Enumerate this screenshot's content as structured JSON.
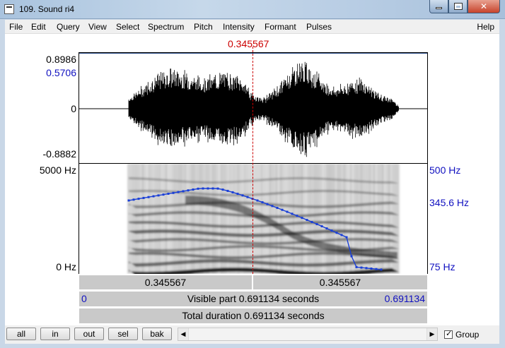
{
  "window": {
    "title": "109. Sound ri4"
  },
  "menu": [
    "File",
    "Edit",
    "Query",
    "View",
    "Select",
    "Spectrum",
    "Pitch",
    "Intensity",
    "Formant",
    "Pulses"
  ],
  "menu_help": "Help",
  "cursor": {
    "time": "0.345567",
    "color": "#cc0000"
  },
  "waveform": {
    "max_label": "0.8986",
    "cursor_value_label": "0.5706",
    "zero_label": "0",
    "min_label": "-0.8882"
  },
  "spectrogram": {
    "freq_top": "5000 Hz",
    "freq_bottom": "0 Hz",
    "pitch_top": "500 Hz",
    "pitch_cursor": "345.6 Hz",
    "pitch_bottom": "75 Hz",
    "pitch_color": "#1a3fd6"
  },
  "bars": {
    "left_part": "0.345567",
    "right_part": "0.345567",
    "visible_start": "0",
    "visible_text": "Visible part 0.691134 seconds",
    "visible_end": "0.691134",
    "total_text": "Total duration 0.691134 seconds"
  },
  "toolbar": {
    "buttons": [
      "all",
      "in",
      "out",
      "sel",
      "bak"
    ],
    "group_label": "Group",
    "group_checked": true
  }
}
